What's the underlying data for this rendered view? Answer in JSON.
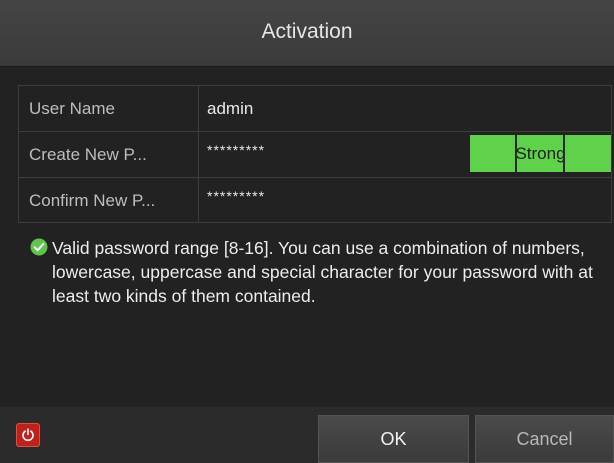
{
  "window": {
    "title": "Activation"
  },
  "form": {
    "rows": [
      {
        "label": "User Name",
        "value": "admin"
      },
      {
        "label": "Create New P...",
        "value": "*********"
      },
      {
        "label": "Confirm New P...",
        "value": "*********"
      }
    ],
    "strength_label": "Strong",
    "strength_color": "#5fd14a"
  },
  "info": {
    "icon": "check-circle-icon",
    "text": "Valid password range [8-16]. You can use a combination of numbers, lowercase, uppercase and special character for your password with at least two kinds of them contained."
  },
  "footer": {
    "power_icon": "power-icon",
    "ok_label": "OK",
    "cancel_label": "Cancel"
  },
  "colors": {
    "background": "#222222",
    "accent_green": "#5fd14a",
    "power_red": "#c0201a"
  }
}
